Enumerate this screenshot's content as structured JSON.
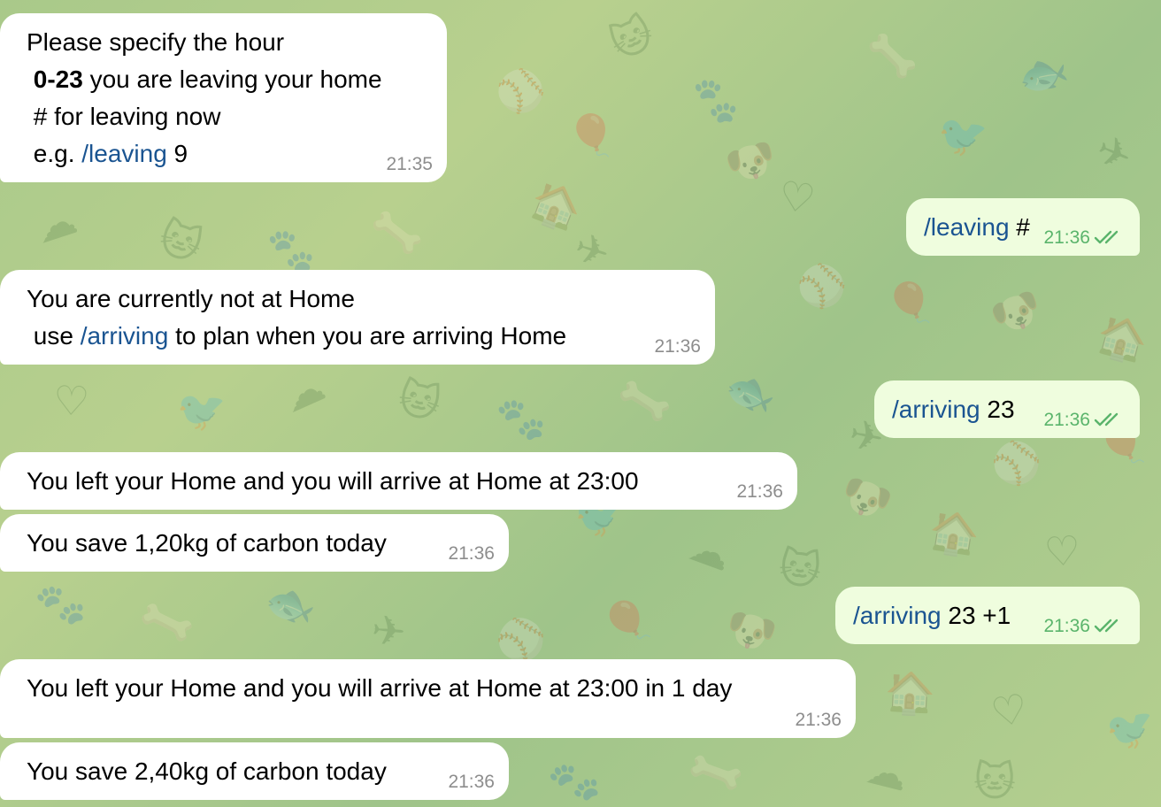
{
  "wallpaper": {
    "icons": [
      "🐱",
      "🐾",
      "🦴",
      "🐟",
      "✈",
      "⚾",
      "🎈",
      "🐶",
      "🏠",
      "♡",
      "🐦",
      "☁"
    ]
  },
  "colors": {
    "incoming_bubble": "#ffffff",
    "outgoing_bubble": "#effdde",
    "command_link": "#1a5491",
    "outgoing_time": "#5ab46b",
    "incoming_time": "#8d8d8d"
  },
  "messages": [
    {
      "direction": "in",
      "lines": [
        [
          {
            "text": "Please specify the hour"
          }
        ],
        [
          {
            "text": " "
          },
          {
            "text": "0-23",
            "style": "bold"
          },
          {
            "text": " you are leaving your home"
          }
        ],
        [
          {
            "text": " # for leaving now"
          }
        ],
        [
          {
            "text": " e.g. "
          },
          {
            "text": "/leaving",
            "style": "cmd"
          },
          {
            "text": " 9"
          }
        ]
      ],
      "time": "21:35"
    },
    {
      "direction": "out",
      "lines": [
        [
          {
            "text": "/leaving",
            "style": "cmd"
          },
          {
            "text": " #"
          }
        ]
      ],
      "time": "21:36",
      "status_icon": "double-check-icon"
    },
    {
      "direction": "in",
      "lines": [
        [
          {
            "text": "You are currently not at Home"
          }
        ],
        [
          {
            "text": " use "
          },
          {
            "text": "/arriving",
            "style": "cmd"
          },
          {
            "text": " to plan when you are arriving Home"
          }
        ]
      ],
      "time": "21:36"
    },
    {
      "direction": "out",
      "lines": [
        [
          {
            "text": "/arriving",
            "style": "cmd"
          },
          {
            "text": " 23"
          }
        ]
      ],
      "time": "21:36",
      "status_icon": "double-check-icon"
    },
    {
      "direction": "in",
      "lines": [
        [
          {
            "text": "You left your Home and you will arrive at Home at 23:00"
          }
        ]
      ],
      "time": "21:36"
    },
    {
      "direction": "in",
      "lines": [
        [
          {
            "text": "You save 1,20kg of carbon today"
          }
        ]
      ],
      "time": "21:36"
    },
    {
      "direction": "out",
      "lines": [
        [
          {
            "text": "/arriving",
            "style": "cmd"
          },
          {
            "text": " 23 +1"
          }
        ]
      ],
      "time": "21:36",
      "status_icon": "double-check-icon"
    },
    {
      "direction": "in",
      "lines": [
        [
          {
            "text": "You left your Home and you will arrive at Home at 23:00 in 1 day"
          }
        ]
      ],
      "time": "21:36"
    },
    {
      "direction": "in",
      "lines": [
        [
          {
            "text": "You save 2,40kg of carbon today"
          }
        ]
      ],
      "time": "21:36"
    }
  ]
}
